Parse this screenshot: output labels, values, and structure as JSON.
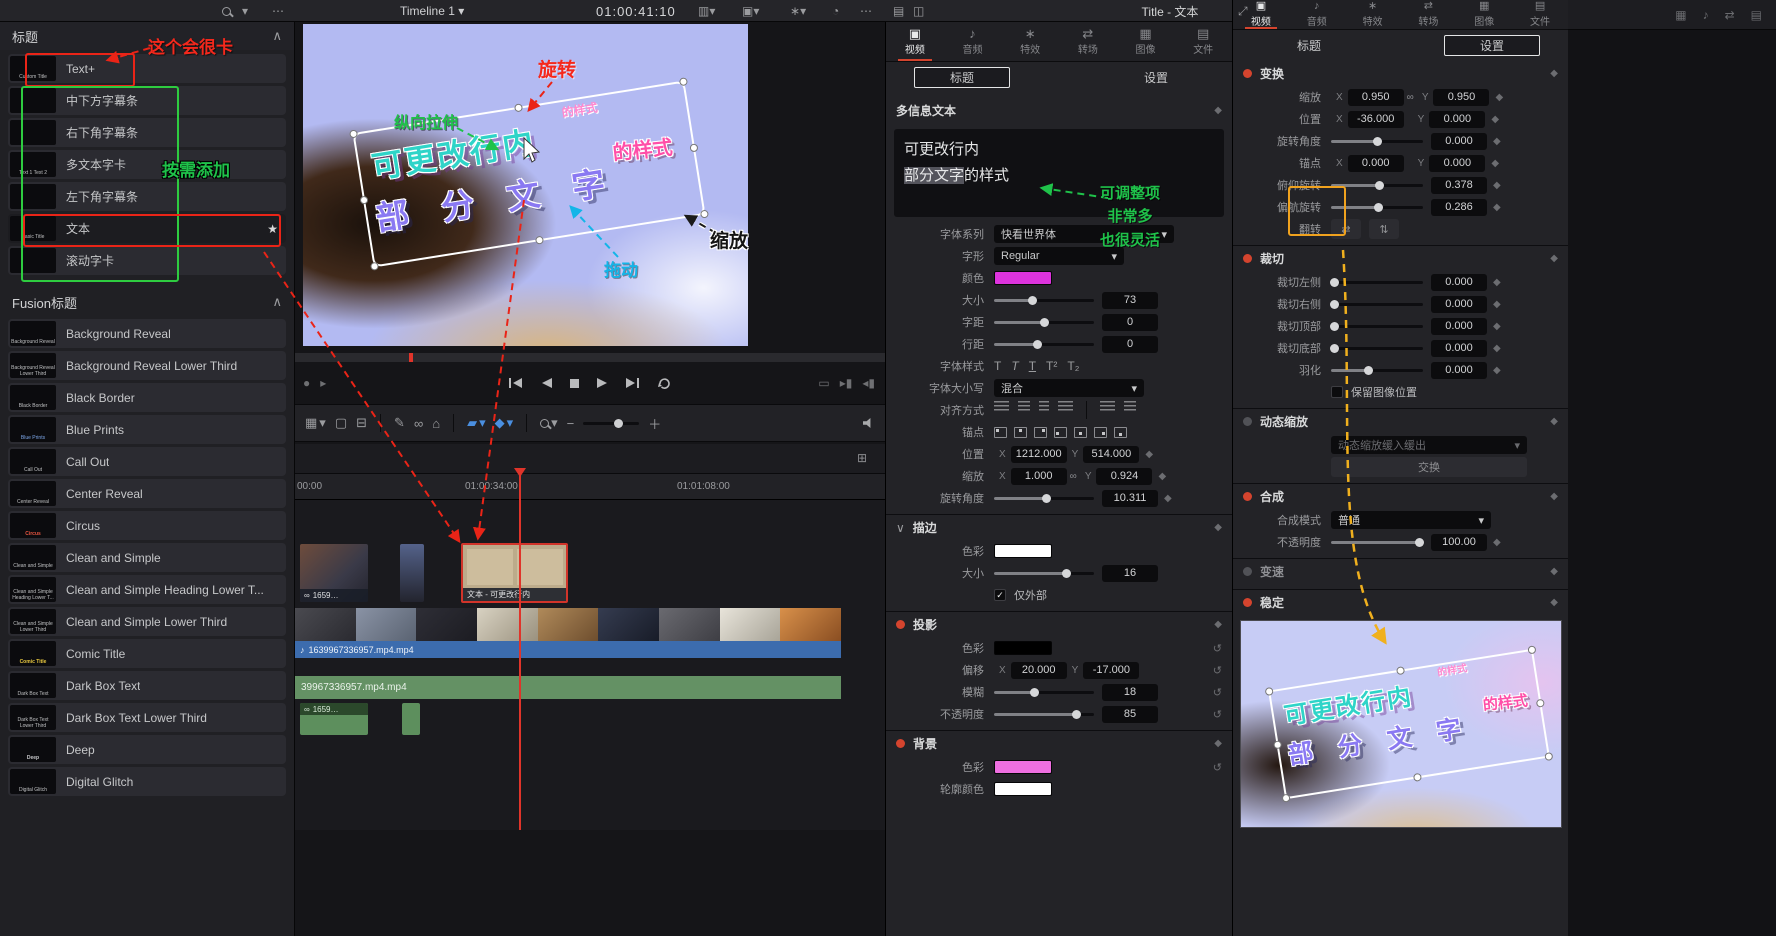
{
  "icons": {
    "caret_down": "▾",
    "chevron_up": "∧",
    "ellipsis": "⋯",
    "star": "★",
    "keyframe": "◆",
    "reset": "↺",
    "link": "∞",
    "check": "✓",
    "music_note": "♪"
  },
  "common": {
    "x": "X",
    "y": "Y"
  },
  "topbar": {
    "timeline_name": "Timeline 1",
    "timecode": "01:00:41:10",
    "window_title": "Title - 文本"
  },
  "panel_tabs": [
    {
      "label": "视频",
      "icon": "▣"
    },
    {
      "label": "音频",
      "icon": "♪"
    },
    {
      "label": "特效",
      "icon": "∗"
    },
    {
      "label": "转场",
      "icon": "⇄"
    },
    {
      "label": "图像",
      "icon": "▦"
    },
    {
      "label": "文件",
      "icon": "▤"
    }
  ],
  "left_panel": {
    "header": "标题",
    "fusion_header": "Fusion标题",
    "title_items": [
      {
        "thumb": "Custom Title",
        "label": "Text+"
      },
      {
        "thumb": "",
        "label": "中下方字幕条"
      },
      {
        "thumb": "",
        "label": "右下角字幕条"
      },
      {
        "thumb": "Text 1 Text 2",
        "label": "多文本字卡"
      },
      {
        "thumb": "",
        "label": "左下角字幕条"
      },
      {
        "thumb": "Basic Title",
        "label": "文本"
      },
      {
        "thumb": "",
        "label": "滚动字卡"
      }
    ],
    "fusion_items": [
      "Background Reveal",
      "Background Reveal Lower Third",
      "Black Border",
      "Blue Prints",
      "Call Out",
      "Center Reveal",
      "Circus",
      "Clean and Simple",
      "Clean and Simple Heading Lower T...",
      "Clean and Simple Lower Third",
      "Comic Title",
      "Dark Box Text",
      "Dark Box Text Lower Third",
      "Deep",
      "Digital Glitch"
    ]
  },
  "viewer": {
    "line1": "可更改行内",
    "line2": "部 分 文 字",
    "suffix": "的样式",
    "ann_rotate": "旋转",
    "ann_stretch": "纵向拉伸",
    "ann_drag": "拖动",
    "ann_scale": "缩放"
  },
  "annotations": {
    "laggy": "这个会很卡",
    "add_as_needed": "按需添加",
    "adjust1": "可调整项",
    "adjust2": "非常多",
    "adjust3": "也很灵活"
  },
  "timeline": {
    "ruler_labels": [
      "00:00",
      "01:00:34:00",
      "01:01:08:00"
    ],
    "clip_photo_label": "1659…",
    "clip_text_label": "文本 - 可更改行内",
    "clip_video_label": "1639967336957.mp4.mp4",
    "audio_track_label": "39967336957.mp4.mp4",
    "audio_clip_label": "1659…"
  },
  "inspectorA": {
    "subtab_title": "标题",
    "subtab_settings": "设置",
    "rich_header": "多信息文本",
    "text_line1": "可更改行内",
    "text_sel": "部分文字",
    "text_rest": "的样式",
    "font_family_label": "字体系列",
    "font_family": "快看世界体",
    "font_face_label": "字形",
    "font_face": "Regular",
    "color_label": "颜色",
    "size_label": "大小",
    "size": "73",
    "tracking_label": "字距",
    "tracking": "0",
    "line_spacing_label": "行距",
    "line_spacing": "0",
    "font_style_label": "字体样式",
    "font_style_icons": [
      "T",
      "T",
      "T",
      "T²",
      "T₂"
    ],
    "case_label": "字体大小写",
    "case_value": "混合",
    "align_label": "对齐方式",
    "anchor_label": "锚点",
    "position_label": "位置",
    "pos_x": "1212.000",
    "pos_y": "514.000",
    "zoom_label": "缩放",
    "zoom_x": "1.000",
    "zoom_y": "0.924",
    "rotation_label": "旋转角度",
    "rotation": "10.311",
    "stroke": {
      "header": "描边",
      "color_label": "色彩",
      "size_label": "大小",
      "size": "16",
      "outside_label": "仅外部"
    },
    "shadow": {
      "header": "投影",
      "color_label": "色彩",
      "offset_label": "偏移",
      "x": "20.000",
      "y": "-17.000",
      "blur_label": "模糊",
      "blur": "18",
      "opacity_label": "不透明度",
      "opacity": "85"
    },
    "background": {
      "header": "背景",
      "color_label": "色彩",
      "outline_label": "轮廓颜色"
    }
  },
  "inspectorB": {
    "subtab_title": "标题",
    "subtab_settings": "设置",
    "transform": {
      "header": "变换",
      "zoom_label": "缩放",
      "zoom_x": "0.950",
      "zoom_y": "0.950",
      "pos_label": "位置",
      "pos_x": "-36.000",
      "pos_y": "0.000",
      "rot_label": "旋转角度",
      "rot": "0.000",
      "anchor_label": "锚点",
      "anchor_x": "0.000",
      "anchor_y": "0.000",
      "pitch_label": "俯仰旋转",
      "pitch": "0.378",
      "yaw_label": "偏航旋转",
      "yaw": "0.286",
      "flip_label": "翻转"
    },
    "crop": {
      "header": "裁切",
      "left_label": "裁切左侧",
      "left": "0.000",
      "right_label": "裁切右侧",
      "right": "0.000",
      "top_label": "裁切顶部",
      "top": "0.000",
      "bottom_label": "裁切底部",
      "bottom": "0.000",
      "softness_label": "羽化",
      "softness": "0.000",
      "retain_label": "保留图像位置"
    },
    "dynamic_zoom": {
      "header": "动态缩放",
      "ease_label": "动态缩放缓入缓出",
      "swap_label": "交换"
    },
    "composite": {
      "header": "合成",
      "mode_label": "合成模式",
      "mode": "普通",
      "opacity_label": "不透明度",
      "opacity": "100.00"
    },
    "speed": {
      "header": "变速"
    },
    "stabilization": {
      "header": "稳定"
    }
  },
  "colors": {
    "accent_red": "#d4442e",
    "text_color_swatch": "#dd33dd",
    "stroke_color_swatch": "#ffffff",
    "shadow_color_swatch": "#000000",
    "background_color_swatch": "#ee6fe0",
    "outline_color_swatch": "#ffffff"
  }
}
